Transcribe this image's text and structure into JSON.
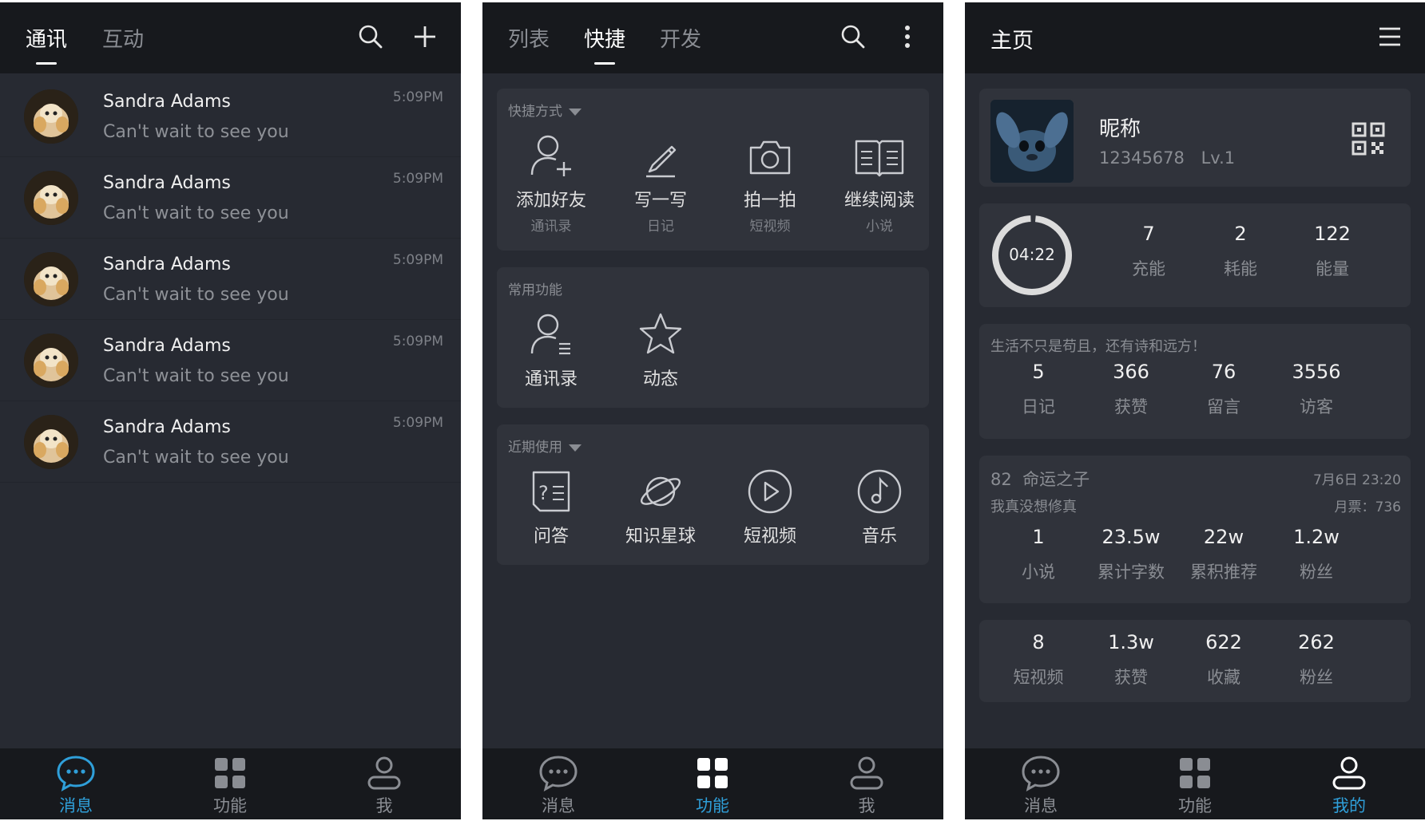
{
  "colors": {
    "accent": "#2f9fd9",
    "background": "#272a32",
    "bar": "#17191d",
    "card": "#30333b"
  },
  "panel1": {
    "tabs": [
      "通讯",
      "互动"
    ],
    "chats": [
      {
        "name": "Sandra Adams",
        "message": "Can't wait to see you",
        "time": "5:09PM"
      },
      {
        "name": "Sandra Adams",
        "message": "Can't wait to see you",
        "time": "5:09PM"
      },
      {
        "name": "Sandra Adams",
        "message": "Can't wait to see you",
        "time": "5:09PM"
      },
      {
        "name": "Sandra Adams",
        "message": "Can't wait to see you",
        "time": "5:09PM"
      },
      {
        "name": "Sandra Adams",
        "message": "Can't wait to see you",
        "time": "5:09PM"
      }
    ],
    "nav": [
      "消息",
      "功能",
      "我"
    ]
  },
  "panel2": {
    "tabs": [
      "列表",
      "快捷",
      "开发"
    ],
    "shortcuts_header": "快捷方式",
    "shortcuts": [
      {
        "label": "添加好友",
        "sub": "通讯录",
        "icon": "add-user-icon"
      },
      {
        "label": "写一写",
        "sub": "日记",
        "icon": "pencil-icon"
      },
      {
        "label": "拍一拍",
        "sub": "短视频",
        "icon": "camera-icon"
      },
      {
        "label": "继续阅读",
        "sub": "小说",
        "icon": "book-icon"
      }
    ],
    "common_header": "常用功能",
    "common": [
      {
        "label": "通讯录",
        "icon": "contacts-icon"
      },
      {
        "label": "动态",
        "icon": "star-icon"
      }
    ],
    "recent_header": "近期使用",
    "recent": [
      {
        "label": "问答",
        "icon": "qa-icon"
      },
      {
        "label": "知识星球",
        "icon": "planet-icon"
      },
      {
        "label": "短视频",
        "icon": "play-icon"
      },
      {
        "label": "音乐",
        "icon": "music-icon"
      }
    ],
    "nav": [
      "消息",
      "功能",
      "我"
    ]
  },
  "panel3": {
    "title": "主页",
    "profile": {
      "nickname": "昵称",
      "id": "12345678",
      "level": "Lv.1"
    },
    "timer": "04:22",
    "energy": [
      {
        "num": "7",
        "label": "充能"
      },
      {
        "num": "2",
        "label": "耗能"
      },
      {
        "num": "122",
        "label": "能量"
      }
    ],
    "motto": "生活不只是苟且，还有诗和远方！",
    "diary": [
      {
        "num": "5",
        "label": "日记"
      },
      {
        "num": "366",
        "label": "获赞"
      },
      {
        "num": "76",
        "label": "留言"
      },
      {
        "num": "3556",
        "label": "访客"
      }
    ],
    "novel": {
      "rank_title": "82  命运之子",
      "date": "7月6日 23:20",
      "subtitle": "我真没想修真",
      "tickets": "月票：736",
      "stats": [
        {
          "num": "1",
          "label": "小说"
        },
        {
          "num": "23.5w",
          "label": "累计字数"
        },
        {
          "num": "22w",
          "label": "累积推荐"
        },
        {
          "num": "1.2w",
          "label": "粉丝"
        }
      ]
    },
    "video": [
      {
        "num": "8",
        "label": "短视频"
      },
      {
        "num": "1.3w",
        "label": "获赞"
      },
      {
        "num": "622",
        "label": "收藏"
      },
      {
        "num": "262",
        "label": "粉丝"
      }
    ],
    "nav": [
      "消息",
      "功能",
      "我的"
    ]
  }
}
